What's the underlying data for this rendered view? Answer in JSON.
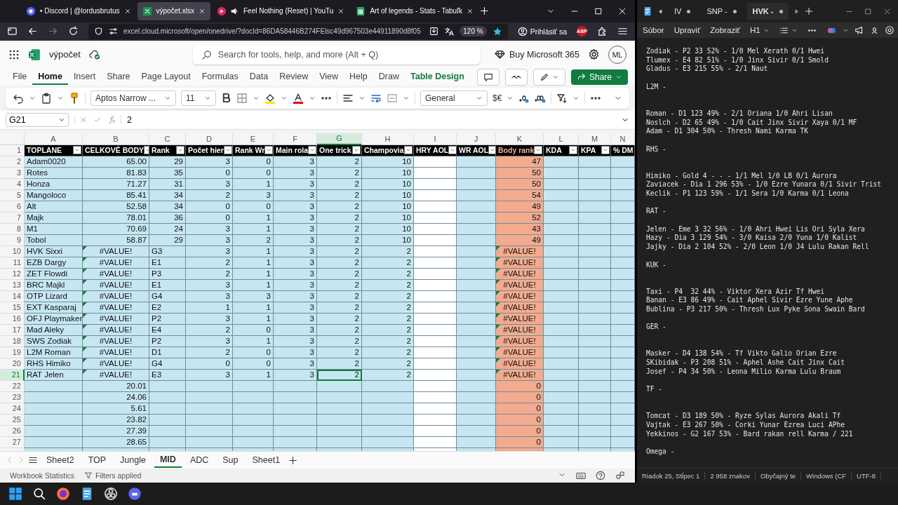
{
  "browser": {
    "tabs": [
      {
        "kind": "discord",
        "title": "• Discord | @lordusbrutus",
        "selected": false
      },
      {
        "kind": "excel",
        "title": "výpočet.xlsx",
        "selected": true
      },
      {
        "kind": "youtube",
        "title": "Feel Nothing (Reset) | YouTu",
        "selected": false
      },
      {
        "kind": "sheets",
        "title": "Art of legends - Stats - Tabuľk",
        "selected": false
      }
    ],
    "url": "excel.cloud.microsoft/open/onedrive/?docId=86DA58446B274FElsc49d967503e44911890d8f05",
    "zoom": "120 %",
    "sign_in": "Prihlásiť sa",
    "addon_badge": "ABP"
  },
  "excel": {
    "file_name": "výpočet",
    "search_placeholder": "Search for tools, help, and more (Alt + Q)",
    "buy": "Buy Microsoft 365",
    "avatar": "ML",
    "ribbon_tabs": [
      {
        "label": "File",
        "kind": "normal",
        "selected": false
      },
      {
        "label": "Home",
        "kind": "normal",
        "selected": true
      },
      {
        "label": "Insert",
        "kind": "normal",
        "selected": false
      },
      {
        "label": "Share",
        "kind": "normal",
        "selected": false
      },
      {
        "label": "Page Layout",
        "kind": "normal",
        "selected": false
      },
      {
        "label": "Formulas",
        "kind": "normal",
        "selected": false
      },
      {
        "label": "Data",
        "kind": "normal",
        "selected": false
      },
      {
        "label": "Review",
        "kind": "normal",
        "selected": false
      },
      {
        "label": "View",
        "kind": "normal",
        "selected": false
      },
      {
        "label": "Help",
        "kind": "normal",
        "selected": false
      },
      {
        "label": "Draw",
        "kind": "normal",
        "selected": false
      },
      {
        "label": "Table Design",
        "kind": "contextual",
        "selected": false
      }
    ],
    "share": "Share",
    "font": "Aptos Narrow ...",
    "font_size": "11",
    "number_format": "General",
    "currency": "$€",
    "name_box": "G21",
    "formula": "2",
    "columns": [
      {
        "letter": "A",
        "kind": "label",
        "filter": true,
        "selected": false
      },
      {
        "letter": "B",
        "kind": "total",
        "filter": true,
        "selected": false
      },
      {
        "letter": "C",
        "kind": "mixed",
        "filter": true,
        "selected": false
      },
      {
        "letter": "D",
        "kind": "number",
        "filter": true,
        "selected": false
      },
      {
        "letter": "E",
        "kind": "number",
        "filter": true,
        "selected": false
      },
      {
        "letter": "F",
        "kind": "number",
        "filter": true,
        "selected": false
      },
      {
        "letter": "G",
        "kind": "number",
        "filter": true,
        "selected": true
      },
      {
        "letter": "H",
        "kind": "number",
        "filter": true,
        "selected": false
      },
      {
        "letter": "I",
        "kind": "blank",
        "filter": true,
        "selected": false
      },
      {
        "letter": "J",
        "kind": "number",
        "filter": true,
        "selected": false
      },
      {
        "letter": "K",
        "kind": "score",
        "filter": true,
        "selected": false
      },
      {
        "letter": "L",
        "kind": "number",
        "filter": true,
        "selected": false
      },
      {
        "letter": "M",
        "kind": "number",
        "filter": true,
        "selected": false
      },
      {
        "letter": "N",
        "kind": "number",
        "filter": false,
        "selected": false
      }
    ],
    "rows": [
      {
        "n": "1",
        "kind": "header",
        "selected": false,
        "cells": {
          "A": "TOPLANE",
          "B": "CELKOVÉ BODY",
          "C": "Rank",
          "D": "Počet hier",
          "E": "Rank Wr",
          "F": "Main rola",
          "G": "One trick",
          "H": "Champovia",
          "I": "HRY AOL",
          "J": "WR AOL",
          "K": "Body rank",
          "L": "KDA",
          "M": "KPA",
          "N": "% DM"
        }
      },
      {
        "n": "2",
        "kind": "seed",
        "selected": false,
        "cells": {
          "A": "Adam0020",
          "B": "65.00",
          "C": "29",
          "D": "3",
          "E": "0",
          "F": "3",
          "G": "2",
          "H": "10",
          "K": "47"
        }
      },
      {
        "n": "3",
        "kind": "seed",
        "selected": false,
        "cells": {
          "A": "Rotes",
          "B": "81.83",
          "C": "35",
          "D": "0",
          "E": "0",
          "F": "3",
          "G": "2",
          "H": "10",
          "K": "50"
        }
      },
      {
        "n": "4",
        "kind": "seed",
        "selected": false,
        "cells": {
          "A": "Honza",
          "B": "71.27",
          "C": "31",
          "D": "3",
          "E": "1",
          "F": "3",
          "G": "2",
          "H": "10",
          "K": "50"
        }
      },
      {
        "n": "5",
        "kind": "seed",
        "selected": false,
        "cells": {
          "A": "Mangoloco",
          "B": "85.41",
          "C": "34",
          "D": "2",
          "E": "3",
          "F": "3",
          "G": "2",
          "H": "10",
          "K": "54"
        }
      },
      {
        "n": "6",
        "kind": "seed",
        "selected": false,
        "cells": {
          "A": "Alt",
          "B": "52.58",
          "C": "34",
          "D": "0",
          "E": "0",
          "F": "3",
          "G": "2",
          "H": "10",
          "K": "49"
        }
      },
      {
        "n": "7",
        "kind": "seed",
        "selected": false,
        "cells": {
          "A": "Majk",
          "B": "78.01",
          "C": "36",
          "D": "0",
          "E": "1",
          "F": "3",
          "G": "2",
          "H": "10",
          "K": "52"
        }
      },
      {
        "n": "8",
        "kind": "seed",
        "selected": false,
        "cells": {
          "A": "M1",
          "B": "70.69",
          "C": "24",
          "D": "3",
          "E": "1",
          "F": "3",
          "G": "2",
          "H": "10",
          "K": "43"
        }
      },
      {
        "n": "9",
        "kind": "seed",
        "selected": false,
        "cells": {
          "A": "Tobol",
          "B": "58.87",
          "C": "29",
          "D": "3",
          "E": "2",
          "F": "3",
          "G": "2",
          "H": "10",
          "K": "49"
        }
      },
      {
        "n": "10",
        "kind": "team",
        "selected": false,
        "cells": {
          "A": "HVK Sixxi",
          "B": "#VALUE!",
          "C": "G3",
          "D": "3",
          "E": "1",
          "F": "3",
          "G": "2",
          "H": "2",
          "K": "#VALUE!"
        }
      },
      {
        "n": "11",
        "kind": "team",
        "selected": false,
        "cells": {
          "A": "EZB Dargy",
          "B": "#VALUE!",
          "C": "E1",
          "D": "2",
          "E": "1",
          "F": "3",
          "G": "2",
          "H": "2",
          "K": "#VALUE!"
        }
      },
      {
        "n": "12",
        "kind": "team",
        "selected": false,
        "cells": {
          "A": "ZET Flowdi",
          "B": "#VALUE!",
          "C": "P3",
          "D": "2",
          "E": "1",
          "F": "3",
          "G": "2",
          "H": "2",
          "K": "#VALUE!"
        }
      },
      {
        "n": "13",
        "kind": "team",
        "selected": false,
        "cells": {
          "A": "BRC Majkl",
          "B": "#VALUE!",
          "C": "E1",
          "D": "3",
          "E": "1",
          "F": "3",
          "G": "2",
          "H": "2",
          "K": "#VALUE!"
        }
      },
      {
        "n": "14",
        "kind": "team",
        "selected": false,
        "cells": {
          "A": "OTP Lizard",
          "B": "#VALUE!",
          "C": "G4",
          "D": "3",
          "E": "3",
          "F": "3",
          "G": "2",
          "H": "2",
          "K": "#VALUE!"
        }
      },
      {
        "n": "15",
        "kind": "team",
        "selected": false,
        "cells": {
          "A": "EXT Kasparaj",
          "B": "#VALUE!",
          "C": "E2",
          "D": "1",
          "E": "1",
          "F": "3",
          "G": "2",
          "H": "2",
          "K": "#VALUE!"
        }
      },
      {
        "n": "16",
        "kind": "team",
        "selected": false,
        "cells": {
          "A": "OFJ Playmaker",
          "B": "#VALUE!",
          "C": "P2",
          "D": "3",
          "E": "1",
          "F": "3",
          "G": "2",
          "H": "2",
          "K": "#VALUE!"
        }
      },
      {
        "n": "17",
        "kind": "team",
        "selected": false,
        "cells": {
          "A": "Mad Aleky",
          "B": "#VALUE!",
          "C": "E4",
          "D": "2",
          "E": "0",
          "F": "3",
          "G": "2",
          "H": "2",
          "K": "#VALUE!"
        }
      },
      {
        "n": "18",
        "kind": "team",
        "selected": false,
        "cells": {
          "A": "SWS Zodiak",
          "B": "#VALUE!",
          "C": "P2",
          "D": "3",
          "E": "1",
          "F": "3",
          "G": "2",
          "H": "2",
          "K": "#VALUE!"
        }
      },
      {
        "n": "19",
        "kind": "team",
        "selected": false,
        "cells": {
          "A": "L2M Roman",
          "B": "#VALUE!",
          "C": "D1",
          "D": "2",
          "E": "0",
          "F": "3",
          "G": "2",
          "H": "2",
          "K": "#VALUE!"
        }
      },
      {
        "n": "20",
        "kind": "team",
        "selected": false,
        "cells": {
          "A": "RHS Himiko",
          "B": "#VALUE!",
          "C": "G4",
          "D": "0",
          "E": "0",
          "F": "3",
          "G": "2",
          "H": "2",
          "K": "#VALUE!"
        }
      },
      {
        "n": "21",
        "kind": "team",
        "selected": true,
        "cells": {
          "A": "RAT Jelen",
          "B": "#VALUE!",
          "C": "E3",
          "D": "3",
          "E": "1",
          "F": "3",
          "G": "2",
          "H": "2",
          "K": "#VALUE!"
        }
      },
      {
        "n": "22",
        "kind": "extra",
        "selected": false,
        "cells": {
          "B": "20.01",
          "K": "0"
        }
      },
      {
        "n": "23",
        "kind": "extra",
        "selected": false,
        "cells": {
          "B": "24.06",
          "K": "0"
        }
      },
      {
        "n": "24",
        "kind": "extra",
        "selected": false,
        "cells": {
          "B": "5.61",
          "K": "0"
        }
      },
      {
        "n": "25",
        "kind": "extra",
        "selected": false,
        "cells": {
          "B": "23.82",
          "K": "0"
        }
      },
      {
        "n": "26",
        "kind": "extra",
        "selected": false,
        "cells": {
          "B": "27.39",
          "K": "0"
        }
      },
      {
        "n": "27",
        "kind": "extra",
        "selected": false,
        "cells": {
          "B": "28.65",
          "K": "0"
        }
      }
    ],
    "sheets": [
      {
        "name": "Sheet2",
        "selected": false
      },
      {
        "name": "TOP",
        "selected": false
      },
      {
        "name": "Jungle",
        "selected": false
      },
      {
        "name": "MID",
        "selected": true
      },
      {
        "name": "ADC",
        "selected": false
      },
      {
        "name": "Sup",
        "selected": false
      },
      {
        "name": "Sheet1",
        "selected": false
      }
    ],
    "status": [
      "Workbook Statistics",
      "Filters applied"
    ]
  },
  "notepad": {
    "tabs": [
      {
        "title": "IV",
        "selected": false
      },
      {
        "title": "SNP -",
        "selected": false
      },
      {
        "title": "HVK -",
        "selected": true
      }
    ],
    "menu": [
      "Súbor",
      "Upraviť",
      "Zobraziť"
    ],
    "heading": "H1",
    "lines": [
      {
        "kind": "line",
        "text": "Zodiak - P2 33 52% - 1/0 Mel Xerath 0/1 Hwei"
      },
      {
        "kind": "line",
        "text": "Tlumex - E4 82 51% - 1/0 Jinx Sivir 0/1 Smold"
      },
      {
        "kind": "line",
        "text": "Gladus - E3 215 55% - 2/1 Naut"
      },
      {
        "kind": "blank"
      },
      {
        "kind": "line",
        "text": "L2M -"
      },
      {
        "kind": "blank"
      },
      {
        "kind": "blank"
      },
      {
        "kind": "line",
        "text": "Roman - D1 123 49% - 2/1 Oriana 1/0 Ahri Lisan"
      },
      {
        "kind": "line",
        "text": "Noslch - D2 65 49% - 1/0 Cait Jinx Sivir Xaya 0/1 MF"
      },
      {
        "kind": "line",
        "text": "Adam - D1 304 50% - Thresh Nami Karma TK"
      },
      {
        "kind": "blank"
      },
      {
        "kind": "line",
        "text": "RHS -"
      },
      {
        "kind": "blank"
      },
      {
        "kind": "blank"
      },
      {
        "kind": "line",
        "text": "Himiko - Gold 4 - - - 1/1 Mel 1/0 LB 0/1 Aurora"
      },
      {
        "kind": "line",
        "text": "Zaviacek - Dia 1 296 53% - 1/0 Ezre Yunara 0/1 Sivir Trist"
      },
      {
        "kind": "line",
        "text": "Keclik - P1 123 59% - 1/1 Sera 1/0 Karma 0/1 Leona"
      },
      {
        "kind": "blank"
      },
      {
        "kind": "line",
        "text": "RAT -"
      },
      {
        "kind": "blank"
      },
      {
        "kind": "line",
        "text": "Jelen - Eme 3 32 56% - 1/0 Ahri Hwei Lis Ori Syla Xera"
      },
      {
        "kind": "line",
        "text": "Hazy - Dia 3 129 54% - 3/0 Kaisa 2/0 Yuna 1/0 Kalist"
      },
      {
        "kind": "line",
        "text": "Jajky - Dia 2 104 52% - 2/0 Leon 1/0 J4 Lulu Rakan Rell"
      },
      {
        "kind": "blank"
      },
      {
        "kind": "line",
        "text": "KUK -"
      },
      {
        "kind": "blank"
      },
      {
        "kind": "blank"
      },
      {
        "kind": "line",
        "text": "Taxi - P4  32 44% - Viktor Xera Azir Tf Hwei"
      },
      {
        "kind": "line",
        "text": "Banan - E3 86 49% - Cait Aphel Sivir Ezre Yune Aphe"
      },
      {
        "kind": "line",
        "text": "Bublina - P3 217 50% - Thresh Lux Pyke Sona Swain Bard"
      },
      {
        "kind": "blank"
      },
      {
        "kind": "line",
        "text": "GER -"
      },
      {
        "kind": "blank"
      },
      {
        "kind": "blank"
      },
      {
        "kind": "line",
        "text": "Masker - D4 138 54% - Tf Vikto Galio Orian Ezre"
      },
      {
        "kind": "line",
        "text": "SKibidak - P3 208 51% - Aphel Ashe Cait Jinx Cait"
      },
      {
        "kind": "line",
        "text": "Josef - P4 34 50% - Leona Milio Karma Lulu Braum"
      },
      {
        "kind": "blank"
      },
      {
        "kind": "line",
        "text": "TF -"
      },
      {
        "kind": "blank"
      },
      {
        "kind": "blank"
      },
      {
        "kind": "line",
        "text": "Tomcat - D3 189 50% - Ryze Sylas Aurora Akali Tf"
      },
      {
        "kind": "line",
        "text": "Vajtak - E3 267 50% - Corki Yunar Ezrea Luci APhe"
      },
      {
        "kind": "line",
        "text": "Yekkinos - G2 167 53% - Bard rakan rell Karma / 221"
      },
      {
        "kind": "blank"
      },
      {
        "kind": "line",
        "text": "Omega -"
      }
    ],
    "status": [
      "Riadok 25, Stĺpec 1",
      "2 958 znakov",
      "Obyčajný te",
      "Windows (CF",
      "UTF-8"
    ]
  }
}
